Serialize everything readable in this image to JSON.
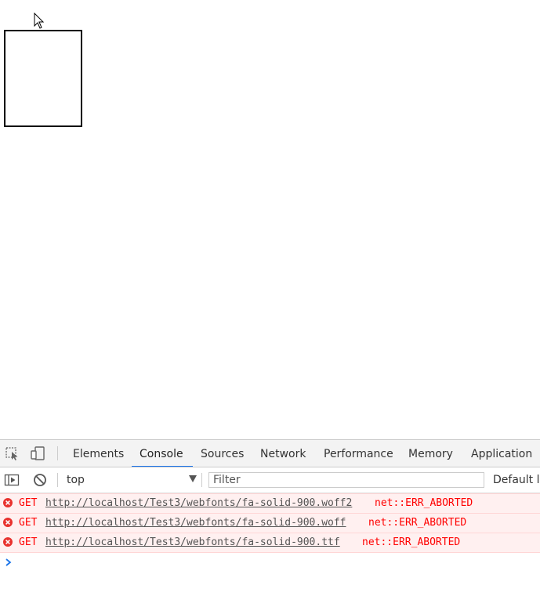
{
  "devtools": {
    "tabs": [
      {
        "label": "Elements",
        "active": false
      },
      {
        "label": "Console",
        "active": true
      },
      {
        "label": "Sources",
        "active": false
      },
      {
        "label": "Network",
        "active": false
      },
      {
        "label": "Performance",
        "active": false
      },
      {
        "label": "Memory",
        "active": false
      },
      {
        "label": "Application",
        "active": false
      }
    ],
    "toolbar_icons": [
      "inspect-element-icon",
      "device-toggle-icon"
    ],
    "console_toolbar": {
      "context": "top",
      "filter_placeholder": "Filter",
      "levels_label": "Default levels"
    },
    "messages": [
      {
        "method": "GET",
        "url": "http://localhost/Test3/webfonts/fa-solid-900.woff2",
        "error": "net::ERR_ABORTED"
      },
      {
        "method": "GET",
        "url": "http://localhost/Test3/webfonts/fa-solid-900.woff",
        "error": "net::ERR_ABORTED"
      },
      {
        "method": "GET",
        "url": "http://localhost/Test3/webfonts/fa-solid-900.ttf",
        "error": "net::ERR_ABORTED"
      }
    ],
    "colors": {
      "accent": "#1a73e8",
      "error_text": "#ff0000",
      "error_bg": "#fff0f0",
      "prompt": "#1a73e8"
    }
  }
}
